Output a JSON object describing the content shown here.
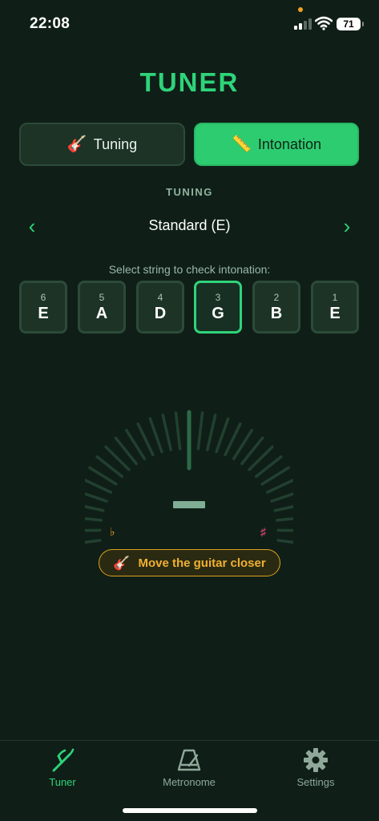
{
  "status_bar": {
    "time": "22:08",
    "battery": "71"
  },
  "app": {
    "title": "TUNER"
  },
  "modes": [
    {
      "label": "Tuning",
      "icon": "guitar-icon",
      "emoji": "🎸",
      "active": false
    },
    {
      "label": "Intonation",
      "icon": "ruler-icon",
      "emoji": "📏",
      "active": true
    }
  ],
  "tuning": {
    "section_label": "TUNING",
    "name": "Standard (E)",
    "prev": "‹",
    "next": "›"
  },
  "hint": "Select string to check intonation:",
  "strings": [
    {
      "num": "6",
      "note": "E"
    },
    {
      "num": "5",
      "note": "A"
    },
    {
      "num": "4",
      "note": "D"
    },
    {
      "num": "3",
      "note": "G",
      "active": true
    },
    {
      "num": "2",
      "note": "B"
    },
    {
      "num": "1",
      "note": "E"
    }
  ],
  "gauge": {
    "flat": "♭",
    "sharp": "♯"
  },
  "warning": {
    "emoji": "🎸",
    "text": "Move the guitar closer"
  },
  "nav": [
    {
      "label": "Tuner",
      "icon": "tuning-fork-icon",
      "active": true
    },
    {
      "label": "Metronome",
      "icon": "metronome-icon",
      "active": false
    },
    {
      "label": "Settings",
      "icon": "gear-icon",
      "active": false
    }
  ],
  "colors": {
    "background": "#0f1f17",
    "accent": "#2fd37a",
    "flat": "#f0a020",
    "sharp": "#e0457a"
  }
}
